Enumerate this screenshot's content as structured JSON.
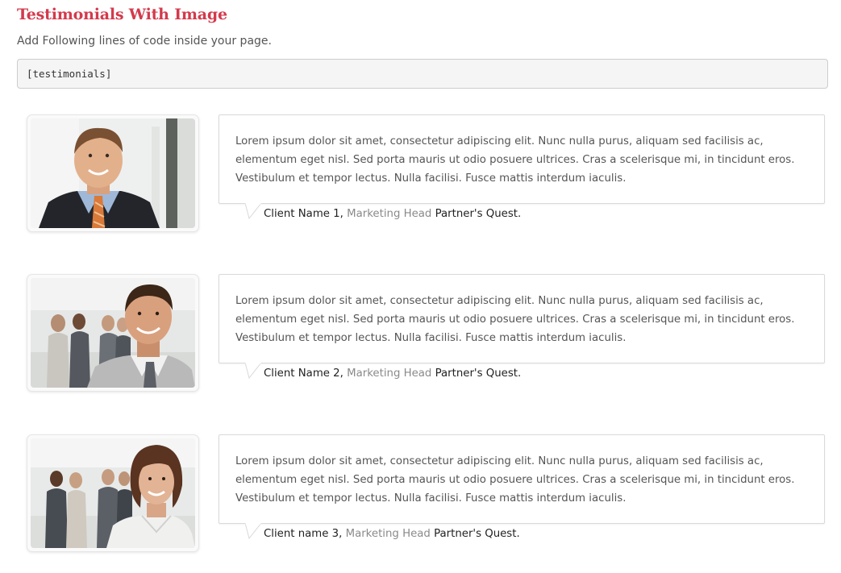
{
  "page": {
    "title": "Testimonials With Image",
    "intro": "Add Following lines of code inside your page.",
    "code_snippet": "[testimonials]"
  },
  "colors": {
    "title": "#d33a4c",
    "role_text": "#8a8a8a",
    "code_background": "#f5f5f5"
  },
  "testimonials": [
    {
      "photo": "businessman-portrait-photo",
      "quote": "Lorem ipsum dolor sit amet, consectetur adipiscing elit. Nunc nulla purus, aliquam sed facilisis ac, elementum eget nisl. Sed porta mauris ut odio posuere ultrices. Cras a scelerisque mi, in tincidunt eros. Vestibulum et tempor lectus. Nulla facilisi. Fusce mattis interdum iaculis.",
      "client_name": "Client Name 1,",
      "role": "Marketing Head",
      "company": "Partner's Quest."
    },
    {
      "photo": "businessman-office-photo",
      "quote": "Lorem ipsum dolor sit amet, consectetur adipiscing elit. Nunc nulla purus, aliquam sed facilisis ac, elementum eget nisl. Sed porta mauris ut odio posuere ultrices. Cras a scelerisque mi, in tincidunt eros. Vestibulum et tempor lectus. Nulla facilisi. Fusce mattis interdum iaculis.",
      "client_name": "Client Name 2,",
      "role": "Marketing Head",
      "company": "Partner's Quest."
    },
    {
      "photo": "businesswoman-office-photo",
      "quote": "Lorem ipsum dolor sit amet, consectetur adipiscing elit. Nunc nulla purus, aliquam sed facilisis ac, elementum eget nisl. Sed porta mauris ut odio posuere ultrices. Cras a scelerisque mi, in tincidunt eros. Vestibulum et tempor lectus. Nulla facilisi. Fusce mattis interdum iaculis.",
      "client_name": "Client name 3,",
      "role": "Marketing Head",
      "company": "Partner's Quest."
    }
  ]
}
